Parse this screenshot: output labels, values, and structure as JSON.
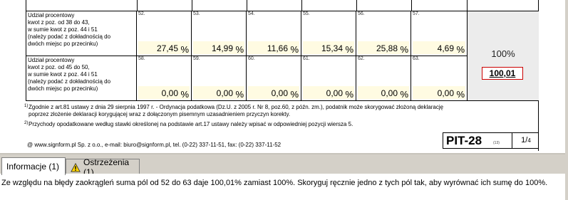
{
  "table": {
    "rows": [
      {
        "label": "Udział procentowy kwot z poz. od 38 do 43, w sumie kwot z poz. 44 i 51 (należy podać z dokładnością do dwóch miejsc po przecinku)",
        "label_lines": [
          "Udział procentowy",
          "kwot z poz. od 38 do 43,",
          "w sumie kwot z poz. 44 i 51",
          "(należy podać z dokładnością do",
          "dwóch miejsc po przecinku)"
        ],
        "cells": [
          {
            "num": "52.",
            "value": "27,45",
            "unit": "%"
          },
          {
            "num": "53.",
            "value": "14,99",
            "unit": "%"
          },
          {
            "num": "54.",
            "value": "11,66",
            "unit": "%"
          },
          {
            "num": "55.",
            "value": "15,34",
            "unit": "%"
          },
          {
            "num": "56.",
            "value": "25,88",
            "unit": "%"
          },
          {
            "num": "57.",
            "value": "4,69",
            "unit": "%"
          }
        ]
      },
      {
        "label": "Udział procentowy kwot z poz. od 45 do 50, w sumie kwot z poz. 44 i 51 (należy podać z dokładnością do dwóch miejsc po przecinku)",
        "label_lines": [
          "Udział procentowy",
          "kwot z poz. od 45 do 50,",
          "w sumie kwot z poz. 44 i 51",
          "(należy podać z dokładnością do",
          "dwóch miejsc po przecinku)"
        ],
        "cells": [
          {
            "num": "58.",
            "value": "0,00",
            "unit": "%"
          },
          {
            "num": "59.",
            "value": "0,00",
            "unit": "%"
          },
          {
            "num": "60.",
            "value": "0,00",
            "unit": "%"
          },
          {
            "num": "61.",
            "value": "0,00",
            "unit": "%"
          },
          {
            "num": "62.",
            "value": "0,00",
            "unit": "%"
          },
          {
            "num": "63.",
            "value": "0,00",
            "unit": "%"
          }
        ]
      }
    ],
    "total_label": "100%",
    "total_value": "100,01"
  },
  "footnotes": {
    "fn1_mark": "1)",
    "fn1_line1": "Zgodnie z art.81 ustawy z dnia 29 sierpnia 1997 r. - Ordynacja podatkowa (Dz.U. z 2005 r. Nr 8, poz.60, z późn. zm.), podatnik może skorygować złożoną deklarację",
    "fn1_line2": "poprzez złożenie deklaracji korygującej wraz z dołączonym pisemnym uzasadnieniem przyczyn korekty.",
    "fn2_mark": "2)",
    "fn2_line1": "Przychody opodatkowane według stawki określonej na podstawie art.17 ustawy należy wpisać w odpowiedniej pozycji wiersza 5."
  },
  "signature": "@ www.signform.pl Sp. z o.o., e-mail: biuro@signform.pl, tel. (0-22) 337-11-51, fax: (0-22) 337-11-52",
  "form_badge": {
    "title": "PIT-28",
    "version": "(13)",
    "page": "1",
    "page_total": "4"
  },
  "tabs": [
    {
      "label": "Informacje (1)",
      "active": true
    },
    {
      "label": "Ostrzeżenia (1)",
      "active": false,
      "icon": "warning-icon"
    }
  ],
  "message": "Ze względu na błędy zaokrągleń suma pól od 52 do 63 daje 100,01% zamiast 100%. Skoryguj ręcznie jedno z tych pól tak, aby wyrównać ich sumę do 100%.",
  "colors": {
    "field_bg": "#fffbe2",
    "error_border": "#cc0000",
    "tab_bar": "#d4d0c8",
    "warning_yellow": "#ffd400"
  }
}
